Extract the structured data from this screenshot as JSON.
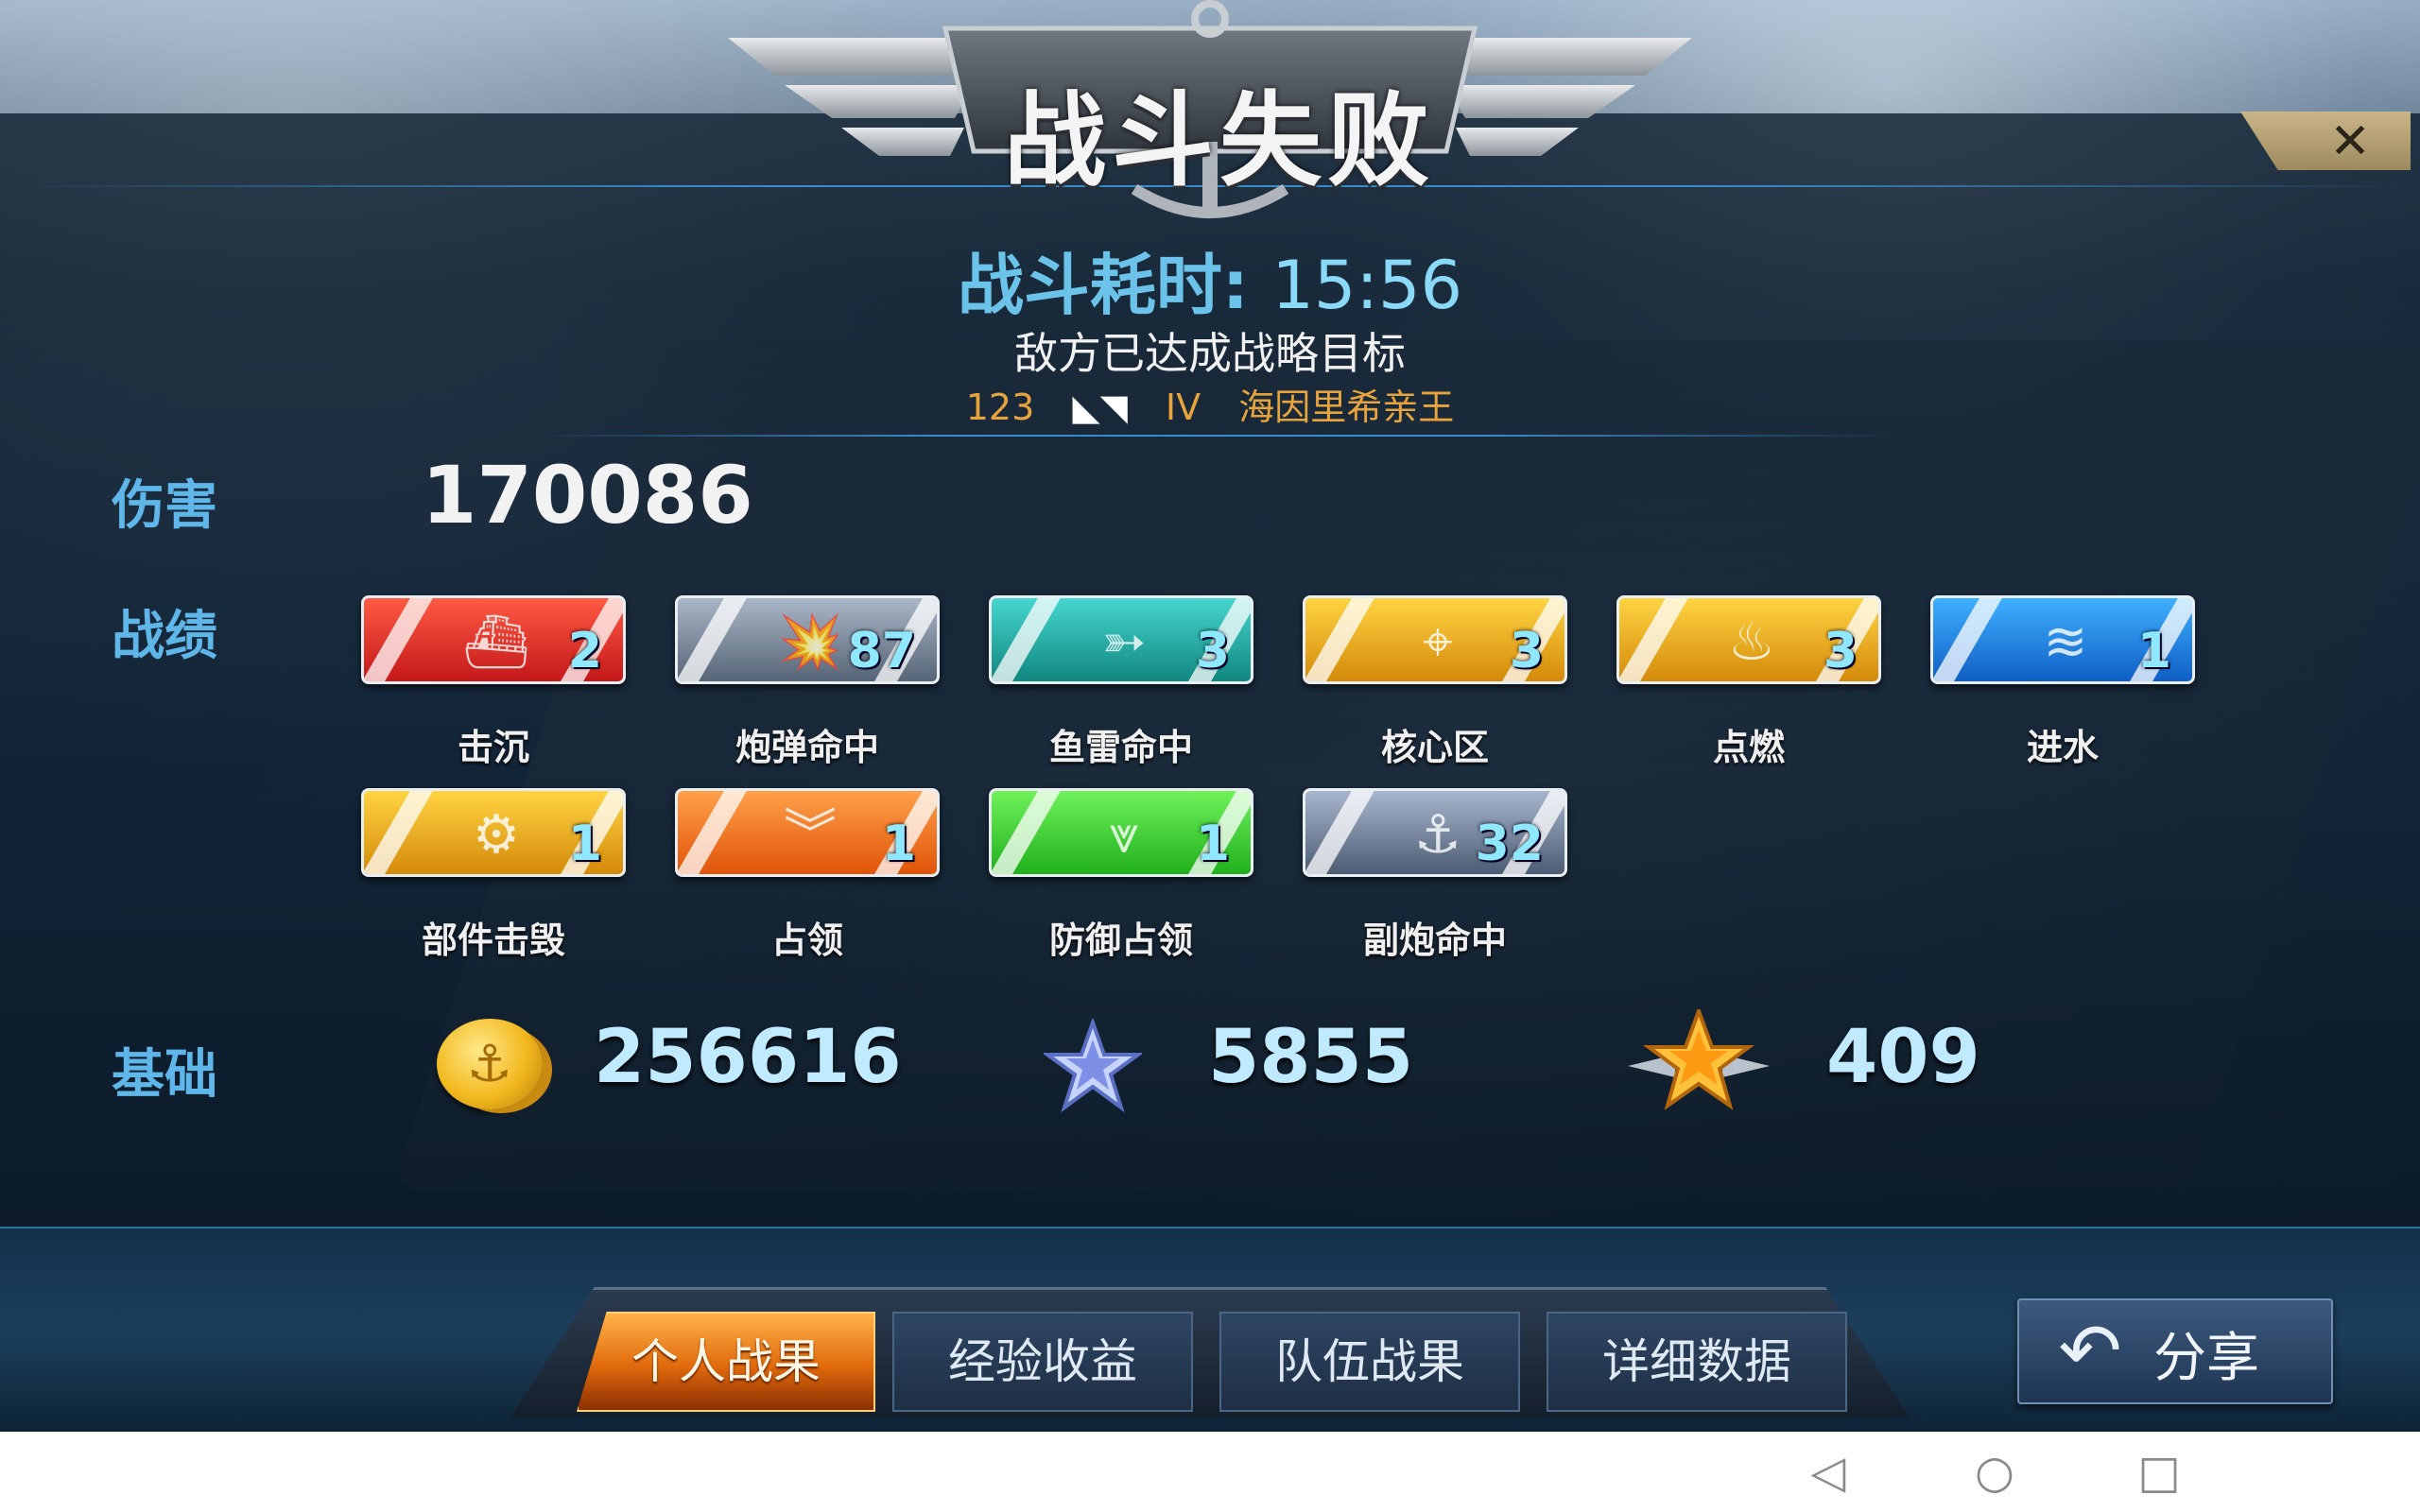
{
  "title": "战斗失败",
  "header": {
    "duration_label": "战斗耗时:",
    "duration_value": "15:56",
    "reason": "敌方已达成战略目标",
    "ship_id": "123",
    "ship_tier": "IV",
    "ship_name": "海因里希亲王"
  },
  "damage": {
    "label": "伤害",
    "value": "170086"
  },
  "achievements": {
    "label": "战绩",
    "medals": [
      {
        "name": "击沉",
        "count": "2",
        "color": "#d92b23",
        "icon": "sunk-ship-icon"
      },
      {
        "name": "炮弹命中",
        "count": "87",
        "color": "#7d8ea3",
        "icon": "shell-hit-icon"
      },
      {
        "name": "鱼雷命中",
        "count": "3",
        "color": "#22b3ab",
        "icon": "torpedo-icon"
      },
      {
        "name": "核心区",
        "count": "3",
        "color": "#e9ad1f",
        "icon": "citadel-icon"
      },
      {
        "name": "点燃",
        "count": "3",
        "color": "#e9ad1f",
        "icon": "fire-icon"
      },
      {
        "name": "进水",
        "count": "1",
        "color": "#1e88e5",
        "icon": "flooding-icon"
      },
      {
        "name": "部件击毁",
        "count": "1",
        "color": "#e9ad1f",
        "icon": "gear-icon"
      },
      {
        "name": "占领",
        "count": "1",
        "color": "#f07a1c",
        "icon": "chevron-down-icon"
      },
      {
        "name": "防御占领",
        "count": "1",
        "color": "#3cd33a",
        "icon": "defend-capture-icon"
      },
      {
        "name": "副炮命中",
        "count": "32",
        "color": "#7d8ea3",
        "icon": "secondary-gun-icon"
      }
    ]
  },
  "base": {
    "label": "基础",
    "credits": "256616",
    "experience": "5855",
    "captain_xp": "409"
  },
  "tabs": [
    {
      "label": "个人战果",
      "active": true
    },
    {
      "label": "经验收益",
      "active": false
    },
    {
      "label": "队伍战果",
      "active": false
    },
    {
      "label": "详细数据",
      "active": false
    }
  ],
  "share": {
    "label": "分享"
  }
}
